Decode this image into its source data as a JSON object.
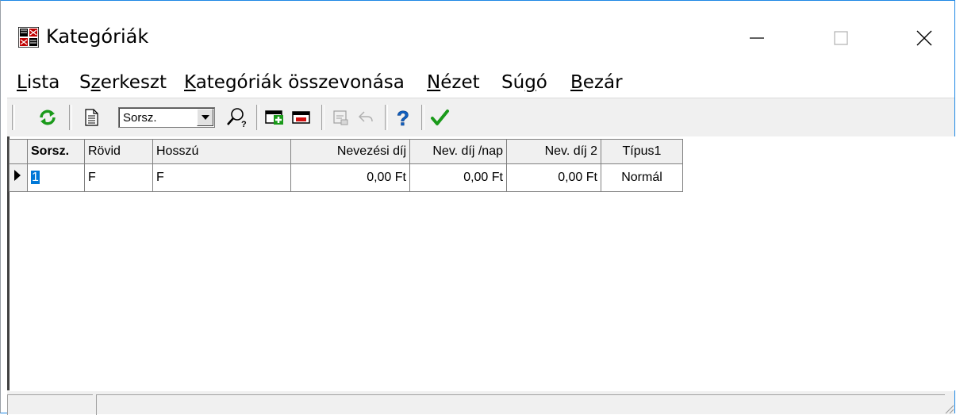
{
  "window": {
    "title": "Kategóriák",
    "app_icon": "grid-app-icon"
  },
  "menu": [
    {
      "label": "Lista",
      "accel": "L",
      "rest": "ista"
    },
    {
      "label": "Szerkeszt",
      "pre": "S",
      "accel": "z",
      "rest": "erkeszt"
    },
    {
      "label": "Kategóriák összevonása",
      "accel": "K",
      "rest": "ategóriák összevonása"
    },
    {
      "label": "Nézet",
      "accel": "N",
      "rest": "ézet"
    },
    {
      "label": "Súgó",
      "pre": "Sú",
      "accel": "g",
      "rest": "ó"
    },
    {
      "label": "Bezár",
      "accel": "B",
      "rest": "ezár"
    }
  ],
  "toolbar": {
    "sort_select_value": "Sorsz.",
    "icons": [
      "refresh-icon",
      "document-icon",
      "search-icon",
      "add-record-icon",
      "delete-record-icon",
      "save-disabled-icon",
      "undo-disabled-icon",
      "help-icon",
      "confirm-icon"
    ]
  },
  "grid": {
    "columns": [
      "Sorsz.",
      "Rövid",
      "Hosszú",
      "Nevezési díj",
      "Nev. díj /nap",
      "Nev. díj 2",
      "Típus1"
    ],
    "rows": [
      [
        "1",
        "F",
        "F",
        "0,00 Ft",
        "0,00 Ft",
        "0,00 Ft",
        "Normál"
      ]
    ]
  },
  "colors": {
    "accent": "#0078d7",
    "green": "#1a9a1a",
    "red": "#d01010",
    "help_blue": "#1060c0"
  }
}
